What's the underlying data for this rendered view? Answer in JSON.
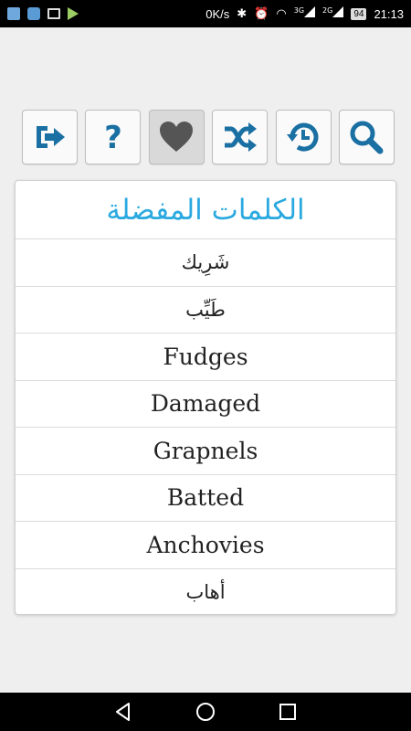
{
  "status_bar": {
    "speed": "0K/s",
    "net1": "3G",
    "net2": "2G",
    "battery": "94",
    "time": "21:13"
  },
  "toolbar": {
    "buttons": [
      {
        "icon": "exit-icon"
      },
      {
        "icon": "help-icon"
      },
      {
        "icon": "heart-icon"
      },
      {
        "icon": "shuffle-icon"
      },
      {
        "icon": "history-icon"
      },
      {
        "icon": "search-icon"
      }
    ],
    "accent": "#1a6fa3"
  },
  "favorites": {
    "title": "الكلمات المفضلة",
    "title_color": "#2aa9e0",
    "items": [
      "شَرِيك",
      "طَيِّب",
      "Fudges",
      "Damaged",
      "Grapnels",
      "Batted",
      "Anchovies",
      "أهاب"
    ]
  }
}
